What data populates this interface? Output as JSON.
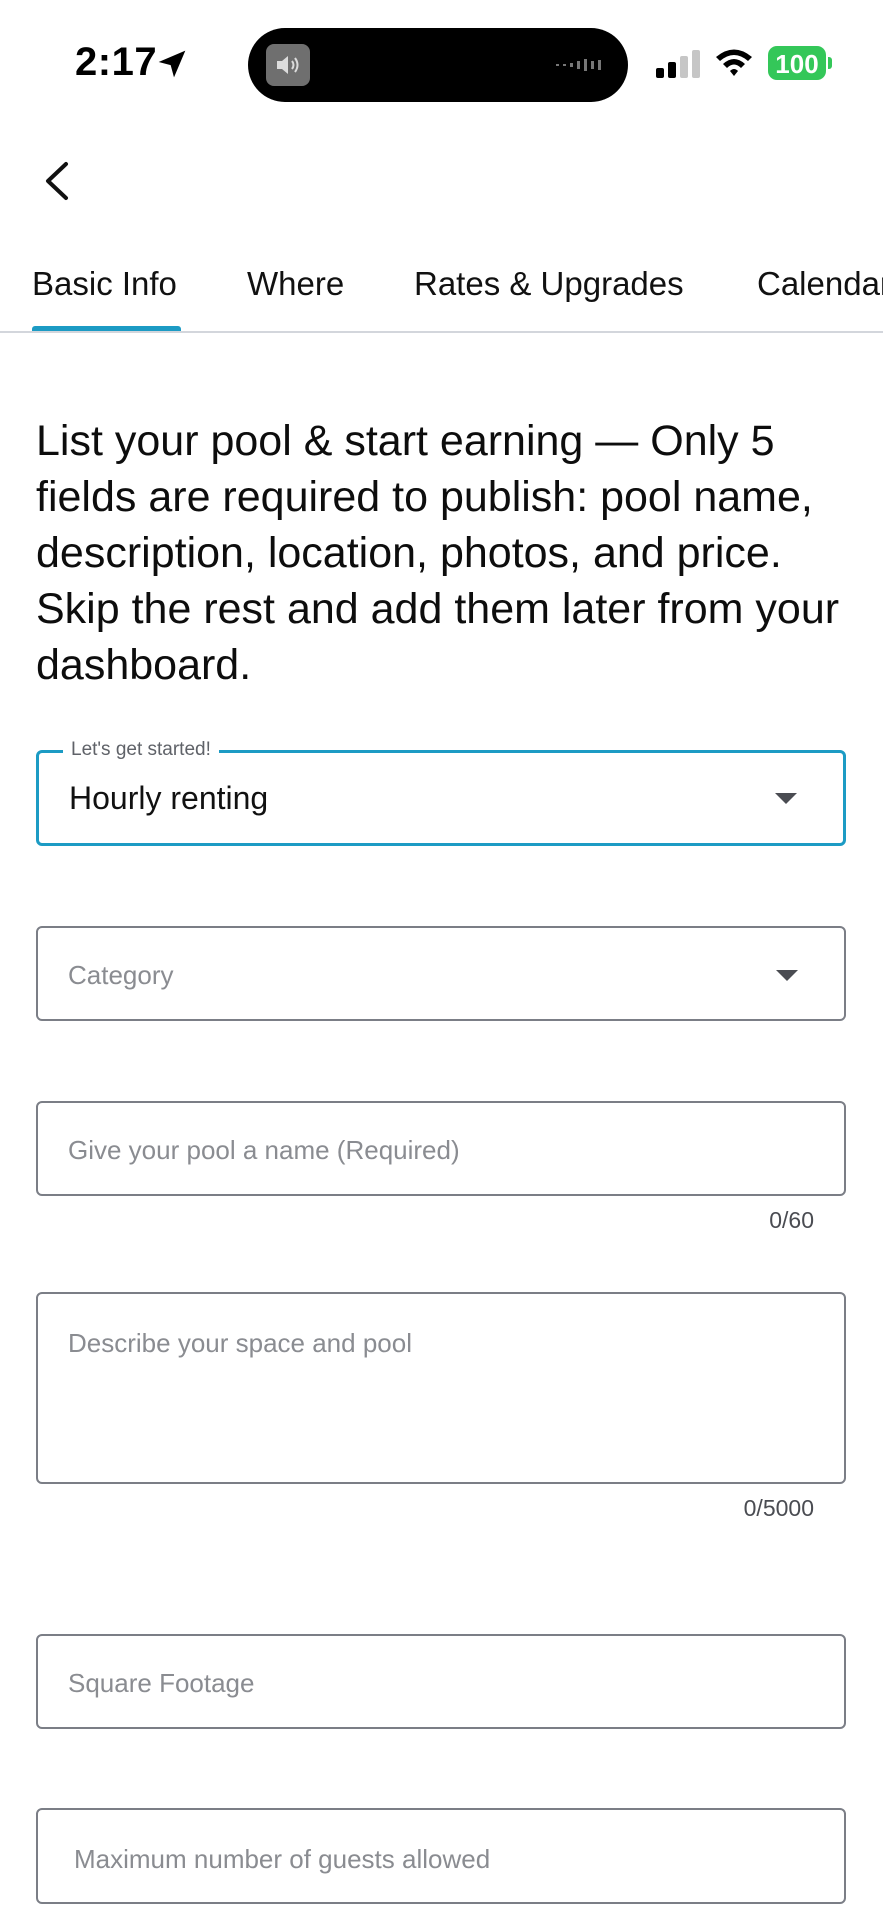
{
  "status_bar": {
    "time": "2:17",
    "battery": "100",
    "icons": [
      "location-arrow-icon",
      "speaker-icon",
      "signal-icon",
      "wifi-icon",
      "battery-icon"
    ]
  },
  "nav": {
    "back_icon": "chevron-left-icon"
  },
  "tabs": [
    {
      "label": "Basic Info",
      "active": true
    },
    {
      "label": "Where"
    },
    {
      "label": "Rates & Upgrades"
    },
    {
      "label": "Calendar"
    }
  ],
  "intro": "List your pool & start earning — Only 5 fields are required to publish: pool name, description, location, photos, and price. Skip the rest and add them later from your dashboard.",
  "form": {
    "rental_type": {
      "label": "Let's get started!",
      "value": "Hourly renting"
    },
    "category": {
      "placeholder": "Category"
    },
    "pool_name": {
      "placeholder": "Give your pool a name (Required)",
      "counter": "0/60"
    },
    "description": {
      "placeholder": "Describe your space and pool",
      "counter": "0/5000"
    },
    "square_footage": {
      "placeholder": "Square Footage"
    },
    "max_guests": {
      "placeholder": "Maximum number of guests allowed"
    }
  },
  "colors": {
    "accent": "#1c9bc4",
    "battery": "#34c759",
    "border": "#7b7e86"
  }
}
